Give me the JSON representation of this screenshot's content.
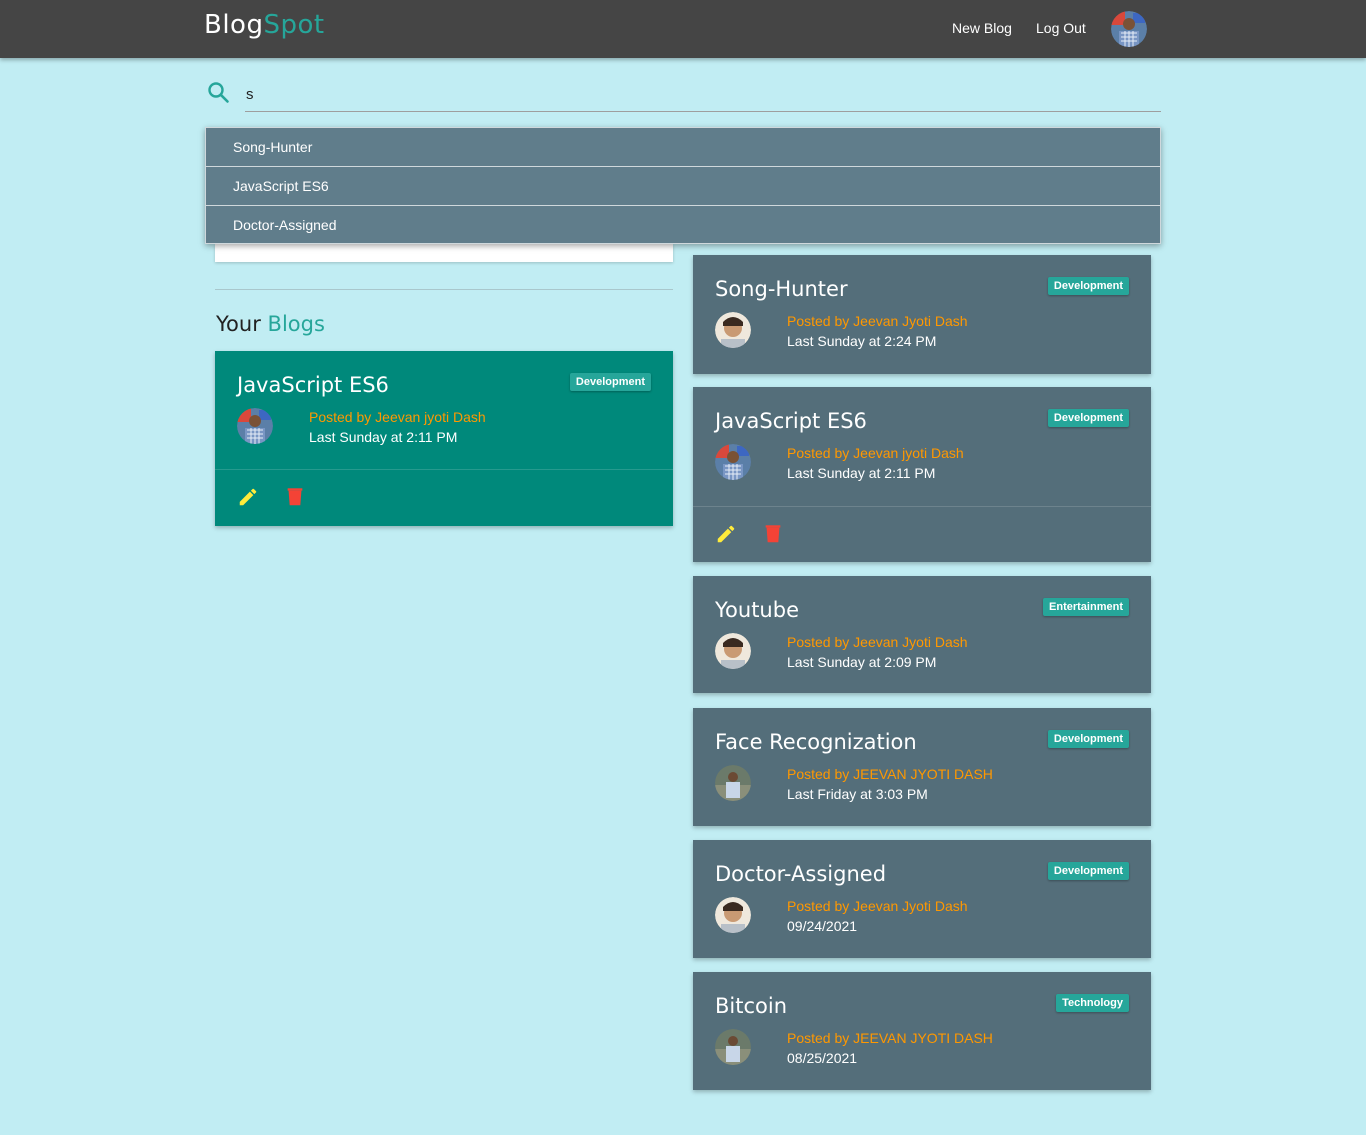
{
  "navbar": {
    "brand_part1": "Blog",
    "brand_part2": "Spot",
    "new_blog_label": "New Blog",
    "logout_label": "Log Out"
  },
  "search": {
    "value": "s"
  },
  "dropdown": {
    "items": [
      "Song-Hunter",
      "JavaScript ES6",
      "Doctor-Assigned"
    ]
  },
  "your_blogs": {
    "title_part1": "Your",
    "title_part2": "Blogs",
    "card": {
      "title": "JavaScript ES6",
      "category": "Development",
      "author": "Posted by Jeevan jyoti Dash",
      "date": "Last Sunday at 2:11 PM"
    }
  },
  "feed": [
    {
      "title": "Song-Hunter",
      "category": "Development",
      "author": "Posted by Jeevan Jyoti Dash",
      "date": "Last Sunday at 2:24 PM"
    },
    {
      "title": "JavaScript ES6",
      "category": "Development",
      "author": "Posted by Jeevan jyoti Dash",
      "date": "Last Sunday at 2:11 PM"
    },
    {
      "title": "Youtube",
      "category": "Entertainment",
      "author": "Posted by Jeevan Jyoti Dash",
      "date": "Last Sunday at 2:09 PM"
    },
    {
      "title": "Face Recognization",
      "category": "Development",
      "author": "Posted by JEEVAN JYOTI DASH",
      "date": "Last Friday at 3:03 PM"
    },
    {
      "title": "Doctor-Assigned",
      "category": "Development",
      "author": "Posted by Jeevan Jyoti Dash",
      "date": "09/24/2021"
    },
    {
      "title": "Bitcoin",
      "category": "Technology",
      "author": "Posted by JEEVAN JYOTI DASH",
      "date": "08/25/2021"
    }
  ],
  "colors": {
    "background": "#c1edf3",
    "navbar": "#454545",
    "accent": "#26a69a",
    "card_teal": "#00897b",
    "card_slate": "#546e7a",
    "dropdown": "#607d8b",
    "author": "#ff9800",
    "edit_icon": "#ffeb3b",
    "delete_icon": "#f44336"
  }
}
